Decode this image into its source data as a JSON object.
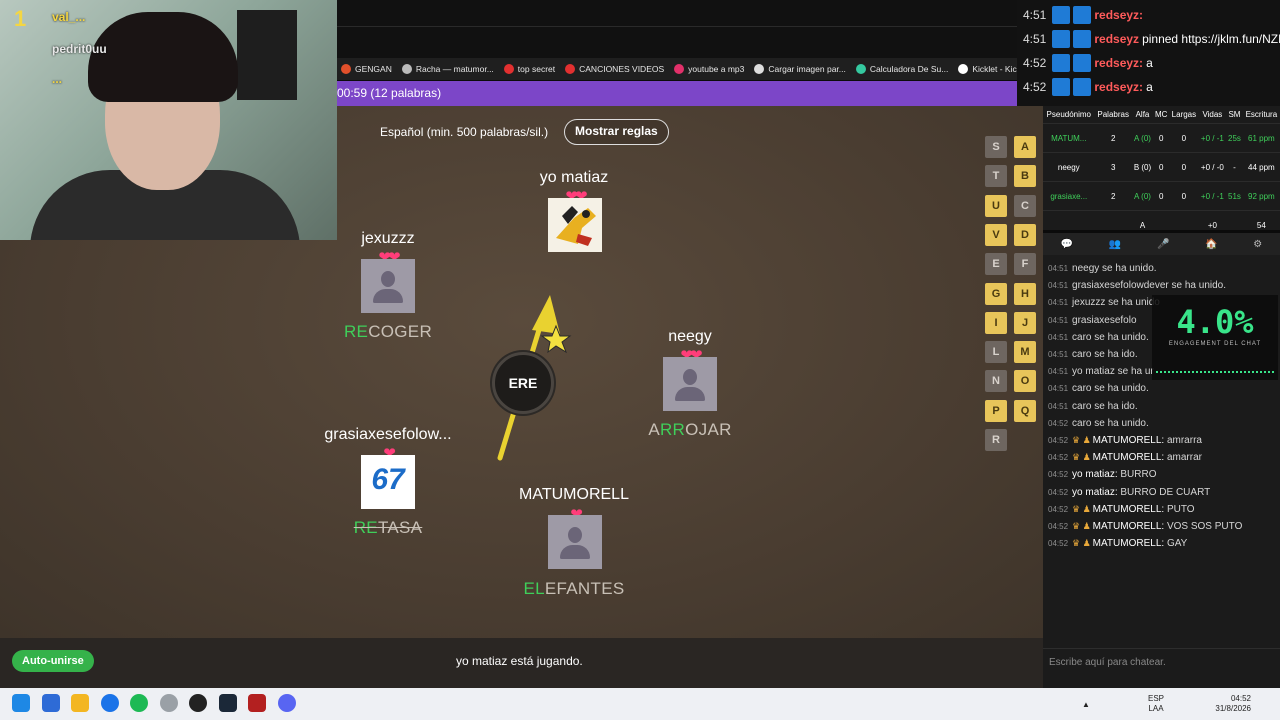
{
  "bookmarks": [
    {
      "label": "GENGAN",
      "color": "#e2502b"
    },
    {
      "label": "Racha — matumor...",
      "color": "#bbbbbb"
    },
    {
      "label": "top secret",
      "color": "#e23030"
    },
    {
      "label": "CANCIONES VIDEOS",
      "color": "#e23030"
    },
    {
      "label": "youtube a mp3",
      "color": "#e2306a"
    },
    {
      "label": "Cargar imagen par...",
      "color": "#dddddd"
    },
    {
      "label": "Calculadora De Su...",
      "color": "#35c9a0"
    },
    {
      "label": "Kicklet - Kick C",
      "color": "#ffffff"
    }
  ],
  "timer": "00:59 (12 palabras)",
  "game": {
    "language": "Español (min. 500 palabras/sil.)",
    "rules_button": "Mostrar reglas",
    "syllable": "ERE",
    "auto_join": "Auto-unirse",
    "status": "yo matiaz está jugando.",
    "players": [
      {
        "name": "yo matiaz",
        "hearts": "❤❤",
        "word_hl": "",
        "word_rest": ""
      },
      {
        "name": "jexuzzz",
        "hearts": "❤❤",
        "word_hl": "RE",
        "word_rest": "COGER"
      },
      {
        "name": "neegy",
        "hearts": "❤❤",
        "word_pre": "A",
        "word_hl": "RR",
        "word_rest": "OJAR"
      },
      {
        "name": "grasiaxesefolow...",
        "hearts": "❤",
        "word_hl": "RE",
        "word_rest": "TASA",
        "avatar_text": "67"
      },
      {
        "name": "MATUMORELL",
        "hearts": "❤",
        "word_hl": "EL",
        "word_rest": "EFANTES"
      }
    ],
    "letters": [
      {
        "l": "S",
        "used": false
      },
      {
        "l": "A",
        "used": true
      },
      {
        "l": "T",
        "used": false
      },
      {
        "l": "B",
        "used": true
      },
      {
        "l": "U",
        "used": true
      },
      {
        "l": "C",
        "used": false
      },
      {
        "l": "V",
        "used": true
      },
      {
        "l": "D",
        "used": true
      },
      {
        "l": "E",
        "used": false
      },
      {
        "l": "F",
        "used": false
      },
      {
        "l": "G",
        "used": true
      },
      {
        "l": "H",
        "used": true
      },
      {
        "l": "I",
        "used": true
      },
      {
        "l": "J",
        "used": true
      },
      {
        "l": "L",
        "used": false
      },
      {
        "l": "M",
        "used": true
      },
      {
        "l": "N",
        "used": false
      },
      {
        "l": "O",
        "used": true
      },
      {
        "l": "P",
        "used": true
      },
      {
        "l": "Q",
        "used": true
      },
      {
        "l": "R",
        "used": false
      }
    ]
  },
  "webcam": {
    "overlay_lines": [
      "val_...",
      "pedrit0uu",
      "..."
    ],
    "rank": "1"
  },
  "top_chat": [
    {
      "time": "4:51",
      "user": "redseyz:",
      "text": ""
    },
    {
      "time": "4:51",
      "user": "redseyz",
      "text": "pinned https://jklm.fun/NZRX"
    },
    {
      "time": "4:52",
      "user": "redseyz:",
      "text": "a"
    },
    {
      "time": "4:52",
      "user": "redseyz:",
      "text": "a"
    }
  ],
  "stats": {
    "headers": [
      "Pseudónimo",
      "Palabras",
      "Alfa",
      "MC",
      "Largas",
      "Vidas",
      "SM",
      "Escritura"
    ],
    "rows": [
      [
        "MATUM...",
        "2",
        "A (0)",
        "0",
        "0",
        "+0 / -1",
        "25s",
        "61 ppm"
      ],
      [
        "neegy",
        "3",
        "B (0)",
        "0",
        "0",
        "+0 / -0",
        "-",
        "44 ppm"
      ],
      [
        "grasiaxe...",
        "2",
        "A (0)",
        "0",
        "0",
        "+0 / -1",
        "51s",
        "92 ppm"
      ],
      [
        "",
        "",
        "A",
        "",
        "",
        "+0",
        "",
        "54"
      ]
    ]
  },
  "chat_tabs": [
    "💬",
    "👥",
    "🎤",
    "🏠",
    "⚙"
  ],
  "chat": [
    {
      "t": "04:51",
      "u": "",
      "m": "neegy se ha unido.",
      "crown": false
    },
    {
      "t": "04:51",
      "u": "",
      "m": "grasiaxesefolowdever se ha unido.",
      "crown": false
    },
    {
      "t": "04:51",
      "u": "",
      "m": "jexuzzz se ha unido",
      "crown": false
    },
    {
      "t": "04:51",
      "u": "",
      "m": "grasiaxesefolo",
      "crown": false
    },
    {
      "t": "04:51",
      "u": "",
      "m": "caro se ha unido.",
      "crown": false
    },
    {
      "t": "04:51",
      "u": "",
      "m": "caro se ha ido.",
      "crown": false
    },
    {
      "t": "04:51",
      "u": "",
      "m": "yo matiaz se ha ur",
      "crown": false
    },
    {
      "t": "04:51",
      "u": "",
      "m": "caro se ha unido.",
      "crown": false
    },
    {
      "t": "04:51",
      "u": "",
      "m": "caro se ha ido.",
      "crown": false
    },
    {
      "t": "04:52",
      "u": "",
      "m": "caro se ha unido.",
      "crown": false
    },
    {
      "t": "04:52",
      "u": "MATUMORELL:",
      "m": "amrarra",
      "crown": true
    },
    {
      "t": "04:52",
      "u": "MATUMORELL:",
      "m": "amarrar",
      "crown": true
    },
    {
      "t": "04:52",
      "u": "yo matiaz:",
      "m": "BURRO",
      "crown": false
    },
    {
      "t": "04:52",
      "u": "yo matiaz:",
      "m": "BURRO DE CUART",
      "crown": false
    },
    {
      "t": "04:52",
      "u": "MATUMORELL:",
      "m": "PUTO",
      "crown": true
    },
    {
      "t": "04:52",
      "u": "MATUMORELL:",
      "m": "VOS SOS PUTO",
      "crown": true
    },
    {
      "t": "04:52",
      "u": "MATUMORELL:",
      "m": "GAY",
      "crown": true
    }
  ],
  "engagement": {
    "value": "4.0%",
    "label": "ENGAGEMENT DEL CHAT"
  },
  "chat_placeholder": "Escribe aquí para chatear.",
  "tray": {
    "lang": "ESP",
    "layout": "LAA",
    "time": "04:52",
    "date": "31/8/2026"
  }
}
